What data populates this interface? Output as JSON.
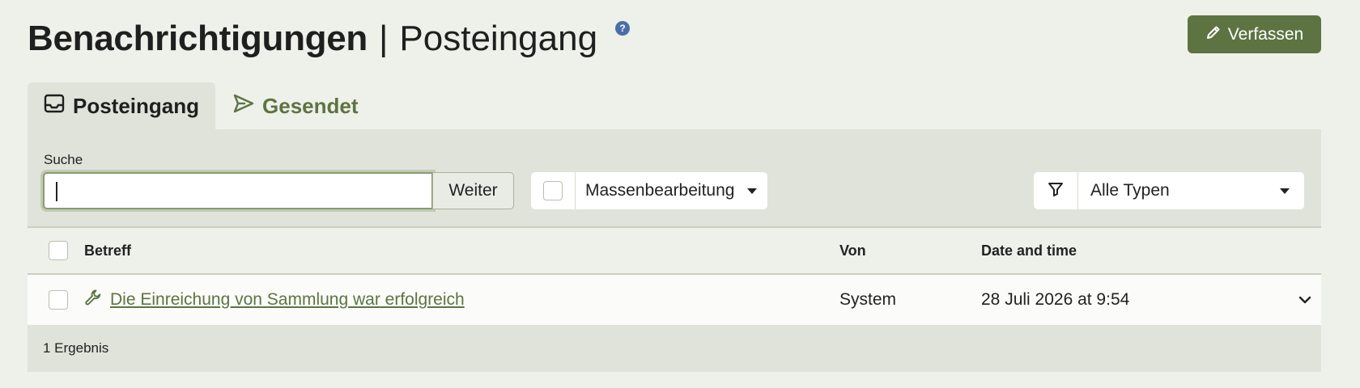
{
  "header": {
    "title_strong": "Benachrichtigungen",
    "separator": "|",
    "title_light": "Posteingang",
    "help_glyph": "?",
    "help_icon": "question-circle-icon"
  },
  "compose_button": {
    "label": "Verfassen",
    "icon": "pencil-icon"
  },
  "tabs": [
    {
      "label": "Posteingang",
      "icon": "inbox-tray-icon",
      "active": true
    },
    {
      "label": "Gesendet",
      "icon": "send-icon",
      "active": false
    }
  ],
  "search": {
    "label": "Suche",
    "value": "",
    "placeholder": "",
    "button_label": "Weiter"
  },
  "bulk_edit": {
    "label": "Massenbearbeitung"
  },
  "type_filter": {
    "icon": "filter-icon",
    "selected": "Alle Typen"
  },
  "table": {
    "columns": [
      "Betreff",
      "Von",
      "Date and time"
    ],
    "rows": [
      {
        "icon": "wrench-icon",
        "subject": "Die Einreichung von Sammlung war erfolgreich",
        "from": "System",
        "date": "28 Juli 2026 at 9:54"
      }
    ],
    "result_count": "1 Ergebnis"
  },
  "colors": {
    "accent": "#5d7442",
    "background": "#eef1ea",
    "panel": "#dfe3d9",
    "help_badge": "#4c6ea8"
  }
}
